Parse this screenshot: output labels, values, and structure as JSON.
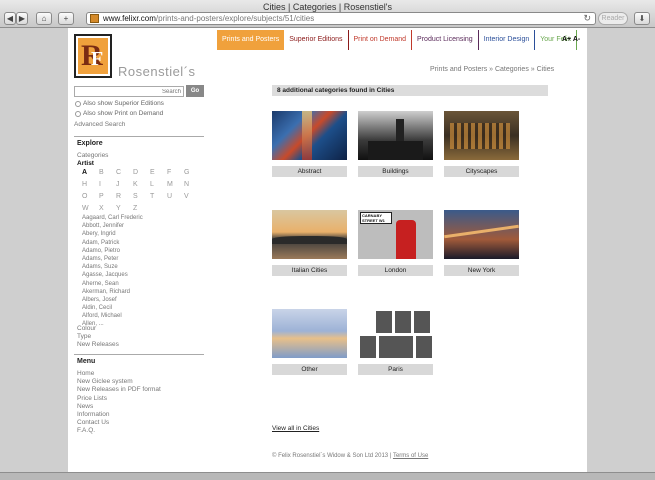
{
  "browser": {
    "window_title": "Cities | Categories | Rosenstiel's",
    "url_domain": "www.felixr.com",
    "url_path": "/prints-and-posters/explore/subjects/51/cities",
    "reader_label": "Reader",
    "back_glyph": "◀",
    "forward_glyph": "▶",
    "home_glyph": "⌂",
    "add_glyph": "+",
    "reload_glyph": "↻",
    "download_glyph": "⬇"
  },
  "brand": {
    "name": "Rosenstiel´s",
    "logo_letters": [
      "F",
      "R"
    ]
  },
  "topnav": {
    "tabs": [
      {
        "label": "Prints and Posters",
        "color": "#ffffff",
        "active": true
      },
      {
        "label": "Superior Editions",
        "color": "#8b1a1a"
      },
      {
        "label": "Print on Demand",
        "color": "#c0392b"
      },
      {
        "label": "Product Licensing",
        "color": "#5a2a5a"
      },
      {
        "label": "Interior Design",
        "color": "#2b4f9a"
      },
      {
        "label": "Your Felix",
        "color": "#6aa84f"
      }
    ],
    "font_size_label": "A+ A-"
  },
  "breadcrumb": "Prints and Posters » Categories » Cities",
  "sidebar": {
    "search_placeholder": "Search",
    "go_label": "Go",
    "checkbox_superior": "Also show Superior Editions",
    "checkbox_pod": "Also show Print on Demand",
    "advanced_search": "Advanced Search",
    "explore_heading": "Explore",
    "categories_link": "Categories",
    "artist_link": "Artist",
    "letters": [
      "A",
      "B",
      "C",
      "D",
      "E",
      "F",
      "G",
      "H",
      "I",
      "J",
      "K",
      "L",
      "M",
      "N",
      "O",
      "P",
      "R",
      "S",
      "T",
      "U",
      "V",
      "W",
      "X",
      "Y",
      "Z"
    ],
    "current_letter": "A",
    "artists": [
      "Aagaard, Carl Frederic",
      "Abbott, Jennifer",
      "Abery, Ingrid",
      "Adam, Patrick",
      "Adamo, Pietro",
      "Adams, Peter",
      "Adams, Suze",
      "Agasse, Jacques",
      "Aherne, Sean",
      "Akerman, Richard",
      "Albers, Josef",
      "Aldin, Cecil",
      "Alford, Michael",
      "Allen, ..."
    ],
    "colour_link": "Colour",
    "type_link": "Type",
    "new_releases_link": "New Releases",
    "menu_heading": "Menu",
    "menu_items": [
      "Home",
      "New Giclee system",
      "New Releases in PDF format",
      "Price Lists",
      "News",
      "Information",
      "Contact Us",
      "F.A.Q."
    ]
  },
  "content": {
    "found_text": "8 additional categories found in Cities",
    "categories": [
      {
        "label": "Abstract",
        "thumb": "abstract"
      },
      {
        "label": "Buildings",
        "thumb": "buildings"
      },
      {
        "label": "Cityscapes",
        "thumb": "cityscapes"
      },
      {
        "label": "Italian Cities",
        "thumb": "italian"
      },
      {
        "label": "London",
        "thumb": "london"
      },
      {
        "label": "New York",
        "thumb": "newyork"
      },
      {
        "label": "Other",
        "thumb": "other"
      },
      {
        "label": "Paris",
        "thumb": "paris"
      }
    ],
    "london_sign": [
      "CARNABY",
      "STREET W1"
    ],
    "view_all": "View all in Cities",
    "footer_text": "© Felix Rosenstiel´s Widow & Son Ltd 2013 |",
    "footer_link": "Terms of Use"
  },
  "colors": {
    "accent": "#f0a13c",
    "label_bg": "#d8d8d8"
  }
}
